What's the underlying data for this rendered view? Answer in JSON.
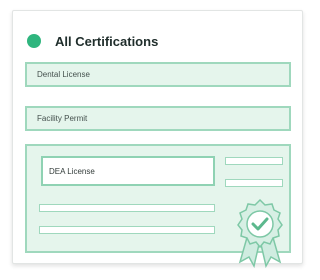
{
  "header": {
    "status_icon": "status-dot-icon",
    "title": "All Certifications"
  },
  "certifications": [
    {
      "label": "Dental License"
    },
    {
      "label": "Facility Permit"
    },
    {
      "label": "DEA License"
    }
  ],
  "badge_icon": "verified-badge-icon",
  "colors": {
    "accent": "#2fb57e",
    "row_fill": "#e5f5ec",
    "row_border": "#9fd8bd"
  }
}
